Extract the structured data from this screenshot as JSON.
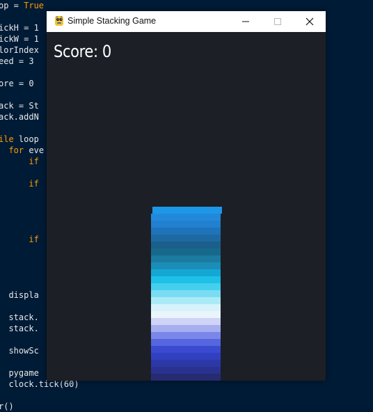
{
  "editor": {
    "lines": [
      {
        "parts": [
          {
            "t": "op = "
          },
          {
            "t": "True",
            "kw": true
          }
        ]
      },
      {
        "parts": [
          {
            "t": ""
          }
        ]
      },
      {
        "parts": [
          {
            "t": "ickH = 1"
          }
        ]
      },
      {
        "parts": [
          {
            "t": "ickW = 1"
          }
        ]
      },
      {
        "parts": [
          {
            "t": "lorIndex"
          }
        ]
      },
      {
        "parts": [
          {
            "t": "eed = 3"
          }
        ]
      },
      {
        "parts": [
          {
            "t": ""
          }
        ]
      },
      {
        "parts": [
          {
            "t": "ore = 0"
          }
        ]
      },
      {
        "parts": [
          {
            "t": ""
          }
        ]
      },
      {
        "parts": [
          {
            "t": "ack = St"
          }
        ]
      },
      {
        "parts": [
          {
            "t": "ack.addN"
          }
        ]
      },
      {
        "parts": [
          {
            "t": ""
          }
        ]
      },
      {
        "parts": [
          {
            "t": "ile loop",
            "kwPrefix": "ile"
          }
        ]
      },
      {
        "parts": [
          {
            "t": "  "
          },
          {
            "t": "for",
            "kw": true
          },
          {
            "t": " eve"
          }
        ]
      },
      {
        "parts": [
          {
            "t": "      "
          },
          {
            "t": "if",
            "kw": true
          }
        ]
      },
      {
        "parts": [
          {
            "t": ""
          }
        ]
      },
      {
        "parts": [
          {
            "t": "      "
          },
          {
            "t": "if",
            "kw": true
          }
        ]
      },
      {
        "parts": [
          {
            "t": ""
          }
        ]
      },
      {
        "parts": [
          {
            "t": ""
          }
        ]
      },
      {
        "parts": [
          {
            "t": ""
          }
        ]
      },
      {
        "parts": [
          {
            "t": ""
          }
        ]
      },
      {
        "parts": [
          {
            "t": "      "
          },
          {
            "t": "if",
            "kw": true
          }
        ]
      },
      {
        "parts": [
          {
            "t": ""
          }
        ]
      },
      {
        "parts": [
          {
            "t": ""
          }
        ]
      },
      {
        "parts": [
          {
            "t": ""
          }
        ]
      },
      {
        "parts": [
          {
            "t": ""
          }
        ]
      },
      {
        "parts": [
          {
            "t": "  displa"
          }
        ]
      },
      {
        "parts": [
          {
            "t": ""
          }
        ]
      },
      {
        "parts": [
          {
            "t": "  stack."
          }
        ]
      },
      {
        "parts": [
          {
            "t": "  stack."
          }
        ]
      },
      {
        "parts": [
          {
            "t": ""
          }
        ]
      },
      {
        "parts": [
          {
            "t": "  showSc"
          }
        ]
      },
      {
        "parts": [
          {
            "t": ""
          }
        ]
      },
      {
        "parts": [
          {
            "t": "  pygame"
          }
        ]
      },
      {
        "parts": [
          {
            "t": "  clock.tick(60)"
          }
        ]
      },
      {
        "parts": [
          {
            "t": ""
          }
        ]
      },
      {
        "parts": [
          {
            "t": "r()"
          }
        ]
      }
    ]
  },
  "window": {
    "title": "Simple Stacking Game",
    "icon": "pygame-snake-icon",
    "controls": [
      "minimize-icon",
      "maximize-icon",
      "close-icon"
    ]
  },
  "game": {
    "score_label": "Score: 0",
    "background": "#1c1f26",
    "moving_block_color": "#1d97e8",
    "stack_colors": [
      "#262b72",
      "#2a3290",
      "#2c38a6",
      "#3140c0",
      "#3a4bd2",
      "#5566de",
      "#7b87e8",
      "#a6aef0",
      "#cfd3f7",
      "#eaf4fb",
      "#d6f2fb",
      "#aaeaf7",
      "#7adcf2",
      "#45cfee",
      "#1ec0e6",
      "#14a7d4",
      "#1b8db7",
      "#1b7a9f",
      "#17698c",
      "#1a5f8a",
      "#1d6aa3",
      "#1f73b8",
      "#2180cf",
      "#2289da"
    ]
  }
}
